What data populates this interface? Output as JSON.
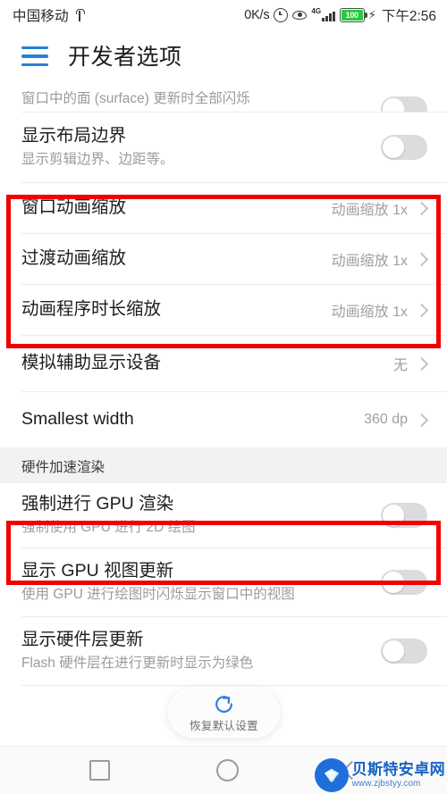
{
  "status_bar": {
    "carrier": "中国移动",
    "usb_icon": "usb-icon",
    "network_speed": "0K/s",
    "alarm_icon": "alarm-clock-icon",
    "eye_icon": "eye-icon",
    "network_type": "4G",
    "battery_level": "100",
    "charging_icon": "⚡",
    "clock": "下午2:56"
  },
  "header": {
    "menu_icon": "hamburger-menu-icon",
    "title": "开发者选项"
  },
  "list": {
    "clipped_row": {
      "subtitle": "窗口中的面 (surface) 更新时全部闪烁"
    },
    "rows": [
      {
        "title": "显示布局边界",
        "subtitle": "显示剪辑边界、边距等。",
        "control": "toggle",
        "toggle_on": false
      },
      {
        "title": "窗口动画缩放",
        "value": "动画缩放 1x",
        "control": "chevron",
        "highlighted": true
      },
      {
        "title": "过渡动画缩放",
        "value": "动画缩放 1x",
        "control": "chevron",
        "highlighted": true
      },
      {
        "title": "动画程序时长缩放",
        "value": "动画缩放 1x",
        "control": "chevron",
        "highlighted": true
      },
      {
        "title": "模拟辅助显示设备",
        "value": "无",
        "control": "chevron"
      },
      {
        "title": "Smallest width",
        "value": "360 dp",
        "control": "chevron"
      }
    ],
    "section_header": "硬件加速渲染",
    "hw_rows": [
      {
        "title": "强制进行 GPU 渲染",
        "subtitle": "强制使用 GPU 进行 2D 绘图",
        "control": "toggle",
        "toggle_on": false,
        "highlighted": true
      },
      {
        "title": "显示 GPU 视图更新",
        "subtitle": "使用 GPU 进行绘图时闪烁显示窗口中的视图",
        "control": "toggle",
        "toggle_on": false
      },
      {
        "title": "显示硬件层更新",
        "subtitle": "Flash 硬件层在进行更新时显示为绿色",
        "control": "toggle",
        "toggle_on": false
      }
    ]
  },
  "restore_pill": {
    "icon": "refresh-restore-icon",
    "label": "恢复默认设置"
  },
  "nav_bar": {
    "recents_icon": "square-recents-icon",
    "home_icon": "circle-home-icon",
    "back_icon": "chevron-left-back-icon"
  },
  "watermark": {
    "name": "贝斯特安卓网",
    "url": "www.zjbstyy.com"
  },
  "colors": {
    "accent_blue": "#2a7fd4",
    "highlight_red": "#f00000",
    "battery_green": "#27c93f",
    "section_bg": "#f2f2f3"
  }
}
